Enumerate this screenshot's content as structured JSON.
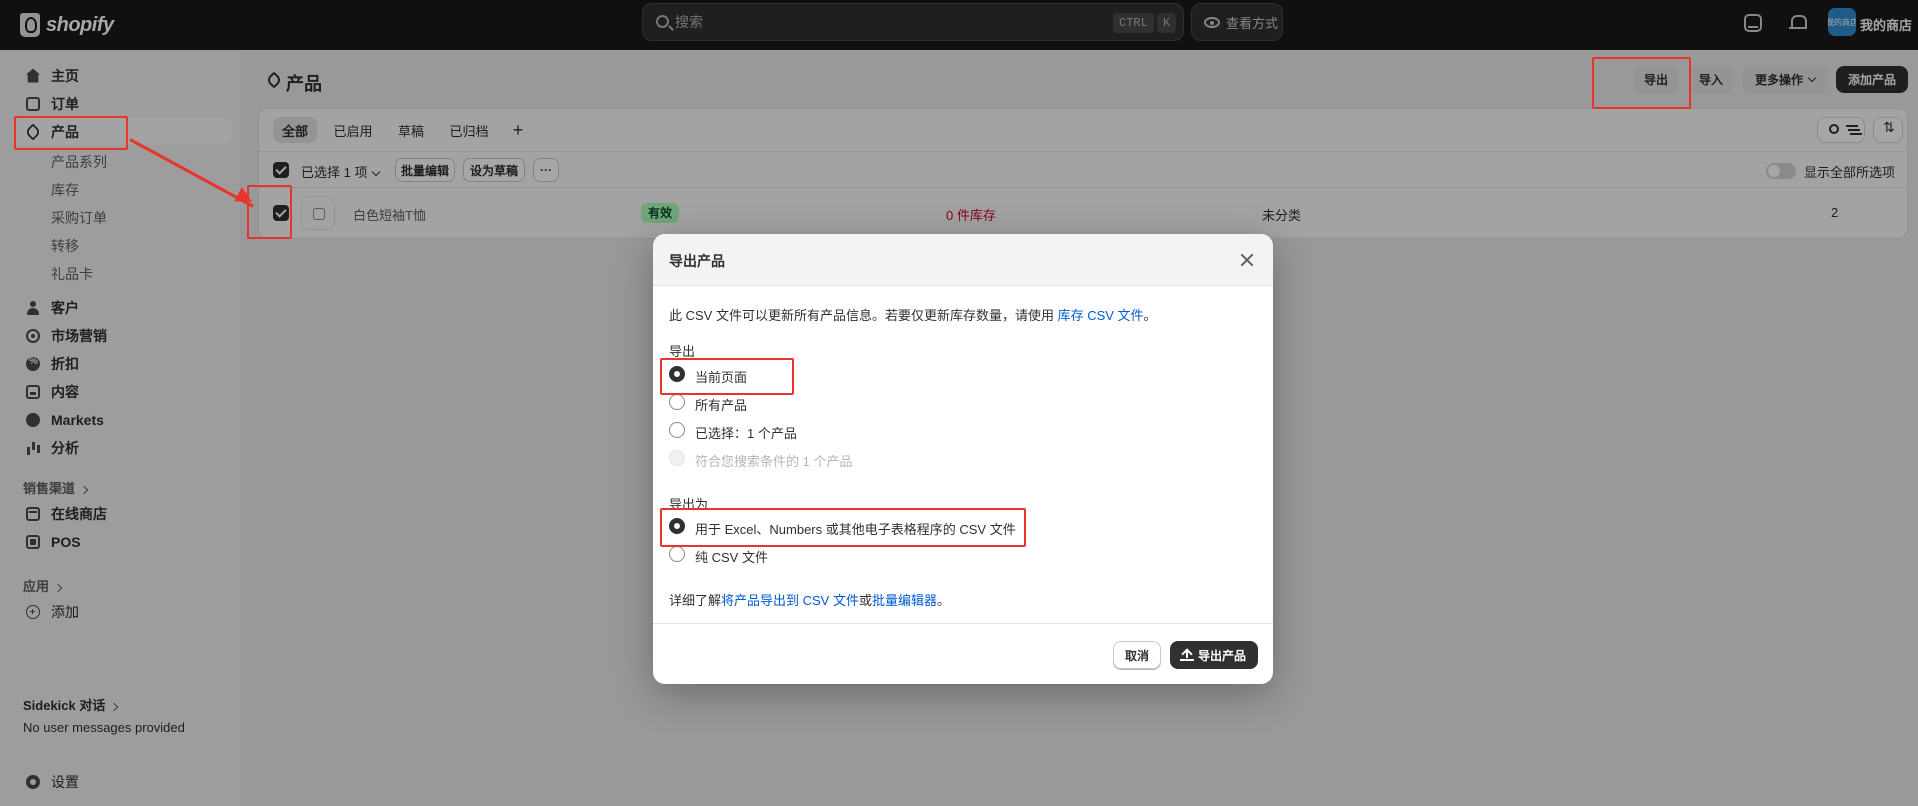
{
  "topbar": {
    "brand": "shopify",
    "search_placeholder": "搜索",
    "shortcut_ctrl": "CTRL",
    "shortcut_k": "K",
    "view_label": "查看方式",
    "store_avatar_text": "我的商店",
    "store_name": "我的商店"
  },
  "sidebar": {
    "items": [
      {
        "label": "主页",
        "icon": "home-icon"
      },
      {
        "label": "订单",
        "icon": "orders-icon"
      },
      {
        "label": "产品",
        "icon": "tag-icon"
      },
      {
        "label": "客户",
        "icon": "person-icon"
      },
      {
        "label": "市场营销",
        "icon": "target-icon"
      },
      {
        "label": "折扣",
        "icon": "discount-icon"
      },
      {
        "label": "内容",
        "icon": "content-icon"
      },
      {
        "label": "Markets",
        "icon": "globe-icon"
      },
      {
        "label": "分析",
        "icon": "chart-icon"
      }
    ],
    "product_sub": [
      "产品系列",
      "库存",
      "采购订单",
      "转移",
      "礼品卡"
    ],
    "sales_channels_label": "销售渠道",
    "channels": [
      {
        "label": "在线商店",
        "icon": "store-icon"
      },
      {
        "label": "POS",
        "icon": "pos-icon"
      }
    ],
    "apps_label": "应用",
    "add_label": "添加",
    "sidekick_label": "Sidekick 对话",
    "sidekick_message": "No user messages provided",
    "settings_label": "设置"
  },
  "page": {
    "title": "产品",
    "buttons": {
      "export": "导出",
      "import": "导入",
      "more": "更多操作",
      "add": "添加产品"
    },
    "tabs": [
      "全部",
      "已启用",
      "草稿",
      "已归档"
    ],
    "add_tab": "+",
    "bulk": {
      "selected": "已选择 1 项",
      "bulk_edit": "批量编辑",
      "set_draft": "设为草稿",
      "more": "···",
      "show_all": "显示全部所选项"
    },
    "product": {
      "name": "白色短袖T恤",
      "status": "有效",
      "stock": "0 件库存",
      "category": "未分类",
      "variants": "2"
    }
  },
  "modal": {
    "title": "导出产品",
    "desc_prefix": "此 CSV 文件可以更新所有产品信息。若要仅更新库存数量，请使用 ",
    "desc_link": "库存 CSV 文件",
    "desc_suffix": "。",
    "export_label": "导出",
    "export_options": [
      {
        "label": "当前页面",
        "checked": true,
        "disabled": false
      },
      {
        "label": "所有产品",
        "checked": false,
        "disabled": false
      },
      {
        "label": "已选择：1 个产品",
        "checked": false,
        "disabled": false
      },
      {
        "label": "符合您搜索条件的 1 个产品",
        "checked": false,
        "disabled": true
      }
    ],
    "export_as_label": "导出为",
    "format_options": [
      {
        "label": "用于 Excel、Numbers 或其他电子表格程序的 CSV 文件",
        "checked": true
      },
      {
        "label": "纯 CSV 文件",
        "checked": false
      }
    ],
    "learn_prefix": "详细了解",
    "learn_link1": "将产品导出到 CSV 文件",
    "learn_mid": "或",
    "learn_link2": "批量编辑器",
    "learn_suffix": "。",
    "cancel": "取消",
    "export_button": "导出产品"
  },
  "colors": {
    "topbar": "#1a1a1a",
    "primary_button": "#303030",
    "link": "#005bd3",
    "success_badge": "#affebf",
    "critical_text": "#c70a24",
    "annotation": "#e8352c"
  }
}
